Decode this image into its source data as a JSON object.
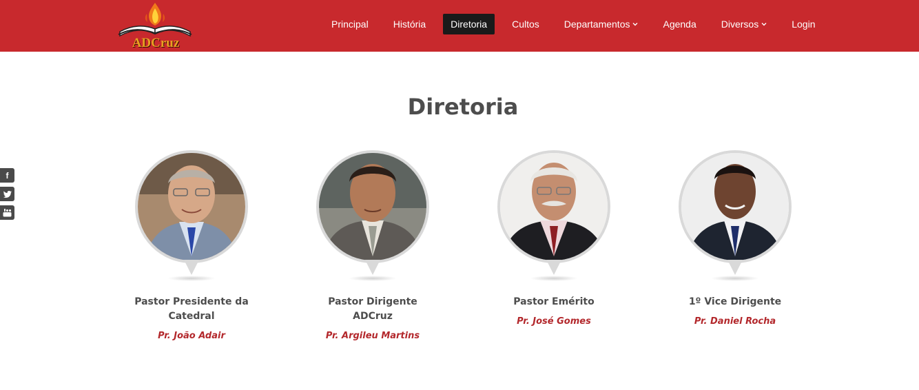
{
  "brand": {
    "logo_text": "ADCruz",
    "accent": "#c8292d"
  },
  "nav": {
    "items": [
      {
        "label": "Principal",
        "active": false,
        "dropdown": false
      },
      {
        "label": "História",
        "active": false,
        "dropdown": false
      },
      {
        "label": "Diretoria",
        "active": true,
        "dropdown": false
      },
      {
        "label": "Cultos",
        "active": false,
        "dropdown": false
      },
      {
        "label": "Departamentos",
        "active": false,
        "dropdown": true
      },
      {
        "label": "Agenda",
        "active": false,
        "dropdown": false
      },
      {
        "label": "Diversos",
        "active": false,
        "dropdown": true
      },
      {
        "label": "Login",
        "active": false,
        "dropdown": false
      }
    ]
  },
  "social": {
    "facebook": "f",
    "twitter": "t",
    "youtube": "You"
  },
  "section": {
    "title": "Diretoria"
  },
  "members": [
    {
      "role_line1": "Pastor Presidente da",
      "role_line2": "Catedral",
      "name": "Pr. João Adair"
    },
    {
      "role_line1": "Pastor Dirigente",
      "role_line2": "ADCruz",
      "name": "Pr. Argileu Martins"
    },
    {
      "role_line1": "Pastor Emérito",
      "role_line2": "",
      "name": "Pr. José Gomes"
    },
    {
      "role_line1": "1º Vice Dirigente",
      "role_line2": "",
      "name": "Pr. Daniel Rocha"
    }
  ]
}
